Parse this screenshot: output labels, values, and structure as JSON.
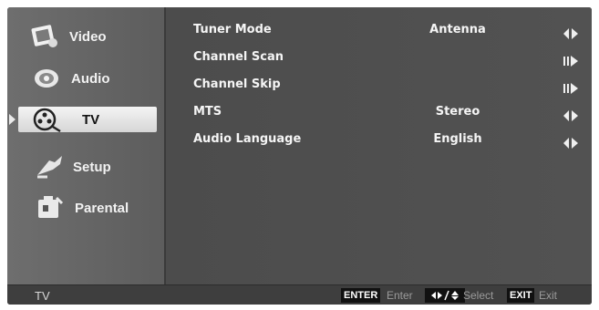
{
  "sidebar": {
    "items": [
      {
        "label": "Video",
        "icon": "video-icon"
      },
      {
        "label": "Audio",
        "icon": "audio-icon"
      },
      {
        "label": "TV",
        "icon": "tv-icon",
        "selected": true
      },
      {
        "label": "Setup",
        "icon": "setup-icon"
      },
      {
        "label": "Parental",
        "icon": "parental-icon"
      }
    ]
  },
  "settings": [
    {
      "name": "Tuner Mode",
      "value": "Antenna",
      "control": "left-right-arrows-icon"
    },
    {
      "name": "Channel Scan",
      "value": "",
      "control": "enter-arrow-icon"
    },
    {
      "name": "Channel Skip",
      "value": "",
      "control": "enter-arrow-icon"
    },
    {
      "name": "MTS",
      "value": "Stereo",
      "control": "left-right-arrows-icon"
    },
    {
      "name": "Audio Language",
      "value": "English",
      "control": "left-right-arrows-icon"
    }
  ],
  "statusbar": {
    "title": "TV",
    "hints": [
      {
        "key": "ENTER",
        "text": "Enter"
      },
      {
        "key_icon": "arrows-key-icon",
        "text": "Select"
      },
      {
        "key": "EXIT",
        "text": "Exit"
      }
    ]
  },
  "colors": {
    "background": "#4a4a4a",
    "sidebar": "#666666",
    "selected_highlight": "#e6e6e6",
    "text": "#f5f5f5"
  }
}
